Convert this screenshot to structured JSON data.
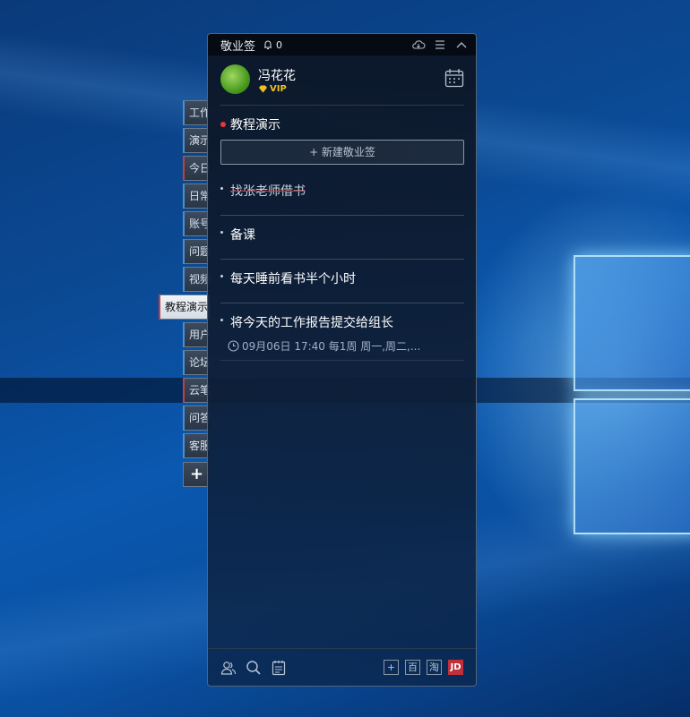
{
  "app": {
    "title": "敬业签",
    "reminder_count": "0"
  },
  "user": {
    "name": "冯花花",
    "badge": "VIP"
  },
  "side_tabs": [
    {
      "label": "工作",
      "accent": "#4a90d0"
    },
    {
      "label": "演示",
      "accent": "#4a90d0"
    },
    {
      "label": "今日",
      "accent": "#c04040"
    },
    {
      "label": "日常",
      "accent": "#4a90d0"
    },
    {
      "label": "账号",
      "accent": "#4a90d0"
    },
    {
      "label": "问题",
      "accent": "#4a90d0"
    },
    {
      "label": "视频",
      "accent": "#4a90d0"
    },
    {
      "label": "教程演示",
      "accent": "#c04040"
    },
    {
      "label": "用户",
      "accent": "#4a90d0"
    },
    {
      "label": "论坛",
      "accent": "#4a90d0"
    },
    {
      "label": "云笔",
      "accent": "#c04040"
    },
    {
      "label": "问答",
      "accent": "#4a90d0"
    },
    {
      "label": "客服",
      "accent": "#4a90d0"
    }
  ],
  "add_tab_label": "+",
  "category": {
    "name": "教程演示",
    "dot_color": "#e83838"
  },
  "new_note_button": "+ 新建敬业签",
  "notes": [
    {
      "text": "找张老师借书",
      "done": true
    },
    {
      "text": "备课",
      "done": false
    },
    {
      "text": "每天睡前看书半个小时",
      "done": false
    },
    {
      "text": "将今天的工作报告提交给组长",
      "done": false,
      "reminder": "09月06日 17:40 每1周 周一,周二,..."
    }
  ],
  "bottom_right_buttons": [
    "+",
    "百",
    "淘",
    "JD"
  ],
  "icons": [
    "bell-icon",
    "cloud-icon",
    "menu-icon",
    "collapse-icon",
    "calendar-icon",
    "contacts-icon",
    "search-icon",
    "notebook-icon",
    "clock-icon",
    "diamond-icon"
  ]
}
